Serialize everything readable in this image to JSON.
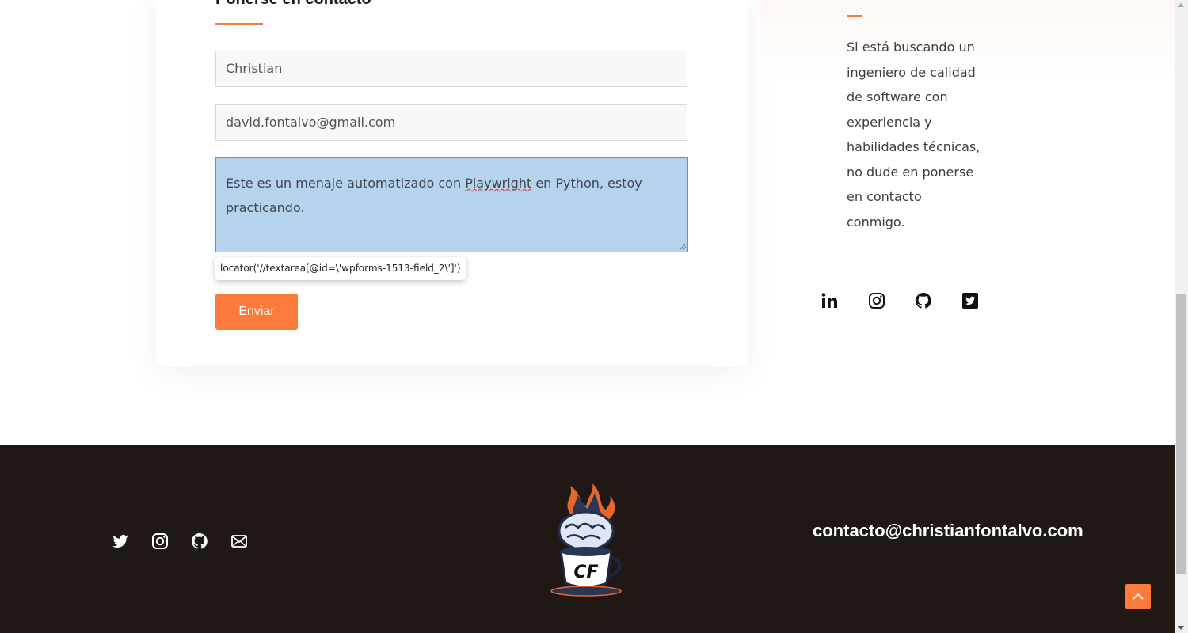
{
  "contact_form": {
    "title": "Ponerse en contacto",
    "name_value": "Christian",
    "email_value": "david.fontalvo@gmail.com",
    "message_before": "Este es un menaje automatizado con ",
    "message_misspelled": "Playwright",
    "message_after": " en Python, estoy practicando.",
    "submit_label": "Enviar"
  },
  "tooltip": {
    "text": "locator('//textarea[@id=\\'wpforms-1513-field_2\\']')"
  },
  "side": {
    "text": "Si está buscando un ingeniero de calidad de software con experiencia y habilidades técnicas, no dude en ponerse en contacto conmigo.",
    "social_icons": [
      "linkedin-icon",
      "instagram-icon",
      "github-icon",
      "twitter-square-icon"
    ]
  },
  "footer": {
    "social_icons": [
      "twitter-icon",
      "instagram-icon",
      "github-icon",
      "mail-icon"
    ],
    "logo_text": "CF",
    "email": "contacto@christianfontalvo.com"
  },
  "colors": {
    "accent": "#fb7a3c",
    "footer_bg": "#201814",
    "textarea_selected": "#b6d3ee"
  }
}
